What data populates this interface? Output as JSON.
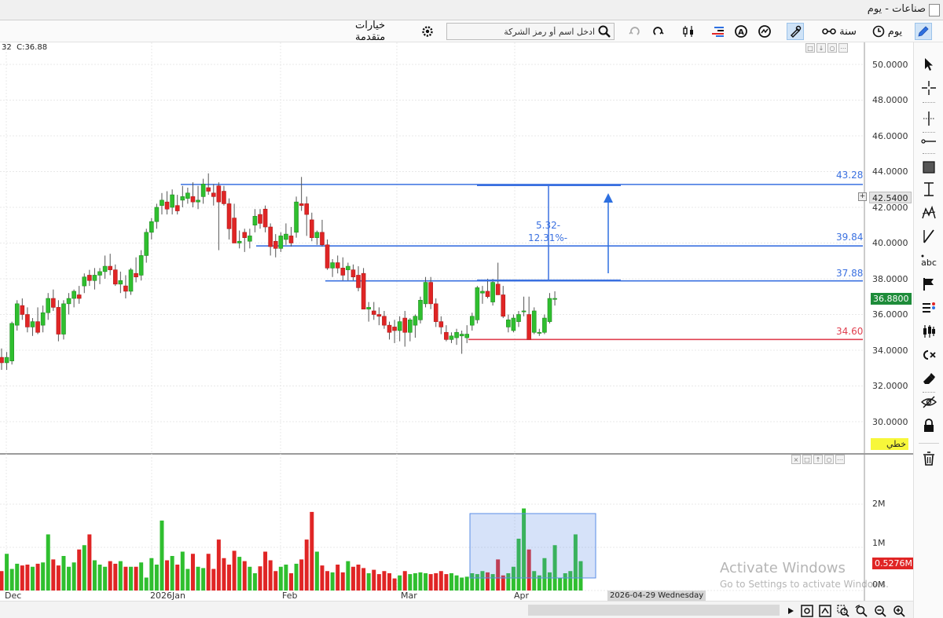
{
  "window": {
    "title": "صناعات - يوم"
  },
  "toolbar": {
    "period_day": "يوم",
    "period_year": "سنة",
    "search_placeholder": "ادخل اسم أو رمز الشركة",
    "advanced_options": "خيارات متقدمة"
  },
  "ohlc_readout": {
    "partial": "32",
    "close": "C:36.88"
  },
  "price_axis": {
    "labels": [
      "50.0000",
      "48.0000",
      "46.0000",
      "44.0000",
      "42.0000",
      "40.0000",
      "38.0000",
      "36.0000",
      "34.0000",
      "32.0000",
      "30.0000"
    ],
    "crosshair_price": "42.5400",
    "last_price": "36.8800",
    "scale_mode": "خطي"
  },
  "volume_axis": {
    "labels": [
      "2M",
      "1M",
      "0M"
    ],
    "last_volume": "0.5276M"
  },
  "date_axis": {
    "labels": [
      "Dec",
      "2026Jan",
      "Feb",
      "Mar",
      "Apr"
    ],
    "cursor_date": "2026-04-29 Wednesday"
  },
  "annotations": {
    "levels": [
      {
        "label": "43.28",
        "price": 43.28,
        "color": "#3a70e0"
      },
      {
        "label": "39.84",
        "price": 39.84,
        "color": "#3a70e0"
      },
      {
        "label": "37.88",
        "price": 37.88,
        "color": "#3a70e0"
      },
      {
        "label": "34.60",
        "price": 34.6,
        "color": "#e04050"
      }
    ],
    "measure_change": "5.32-",
    "measure_percent": "12.31%-"
  },
  "watermark": {
    "line1": "Activate Windows",
    "line2": "Go to Settings to activate Windows."
  },
  "colors": {
    "up": "#2fbf2f",
    "down": "#e02525",
    "level": "#3a70e0",
    "support": "#e04050",
    "last_price_tag": "#1e8c3a"
  },
  "chart_data": {
    "type": "candlestick",
    "ylim": [
      29,
      51
    ],
    "series": [
      {
        "name": "price",
        "ohlc": [
          [
            33.6,
            34.1,
            32.9,
            33.3
          ],
          [
            33.3,
            33.9,
            32.9,
            33.6
          ],
          [
            33.4,
            35.6,
            33.2,
            35.5
          ],
          [
            35.4,
            36.8,
            35.1,
            36.6
          ],
          [
            36.5,
            36.9,
            35.7,
            36.0
          ],
          [
            36.0,
            36.4,
            35.0,
            35.3
          ],
          [
            35.3,
            35.8,
            34.8,
            35.6
          ],
          [
            35.6,
            36.4,
            34.9,
            35.0
          ],
          [
            35.4,
            36.5,
            35.0,
            36.1
          ],
          [
            36.1,
            37.2,
            35.7,
            36.9
          ],
          [
            36.9,
            37.4,
            36.2,
            36.4
          ],
          [
            36.4,
            36.8,
            34.5,
            34.9
          ],
          [
            34.9,
            36.8,
            34.6,
            36.6
          ],
          [
            36.6,
            37.2,
            36.0,
            36.9
          ],
          [
            36.9,
            37.4,
            36.4,
            37.3
          ],
          [
            37.1,
            37.6,
            36.6,
            36.9
          ],
          [
            37.6,
            38.3,
            37.2,
            38.1
          ],
          [
            38.2,
            38.5,
            37.6,
            37.9
          ],
          [
            37.9,
            38.6,
            37.4,
            38.2
          ],
          [
            38.2,
            38.6,
            37.7,
            38.4
          ],
          [
            38.4,
            39.3,
            38.0,
            38.7
          ],
          [
            38.7,
            39.4,
            38.2,
            38.5
          ],
          [
            38.5,
            38.8,
            37.6,
            37.7
          ],
          [
            37.7,
            38.4,
            37.2,
            37.9
          ],
          [
            37.6,
            38.2,
            36.9,
            37.3
          ],
          [
            37.3,
            38.6,
            37.1,
            38.5
          ],
          [
            38.3,
            39.2,
            37.8,
            38.1
          ],
          [
            38.2,
            39.6,
            37.9,
            39.3
          ],
          [
            39.3,
            40.8,
            38.9,
            40.6
          ],
          [
            40.6,
            41.4,
            40.2,
            41.2
          ],
          [
            41.2,
            42.2,
            40.8,
            42.0
          ],
          [
            42.1,
            42.8,
            41.6,
            42.4
          ],
          [
            42.3,
            42.9,
            41.6,
            41.9
          ],
          [
            42.0,
            43.0,
            41.6,
            42.7
          ],
          [
            42.1,
            42.7,
            41.6,
            41.8
          ],
          [
            42.4,
            43.2,
            42.0,
            42.6
          ],
          [
            42.5,
            43.1,
            42.2,
            42.8
          ],
          [
            42.6,
            43.4,
            42.0,
            42.3
          ],
          [
            42.3,
            43.2,
            41.9,
            42.4
          ],
          [
            42.6,
            43.6,
            42.2,
            43.3
          ],
          [
            43.1,
            43.9,
            42.7,
            42.9
          ],
          [
            42.8,
            43.3,
            42.1,
            42.6
          ],
          [
            43.2,
            43.4,
            39.6,
            42.3
          ],
          [
            42.9,
            43.2,
            42.1,
            42.2
          ],
          [
            42.2,
            42.5,
            40.2,
            40.8
          ],
          [
            41.4,
            42.2,
            40.1,
            40.0
          ],
          [
            40.0,
            40.7,
            39.7,
            40.1
          ],
          [
            40.6,
            40.8,
            39.5,
            40.3
          ],
          [
            40.1,
            40.8,
            39.7,
            40.4
          ],
          [
            41.0,
            41.9,
            40.6,
            41.5
          ],
          [
            41.6,
            41.9,
            40.8,
            41.1
          ],
          [
            41.9,
            42.1,
            40.6,
            40.9
          ],
          [
            40.9,
            41.1,
            39.3,
            39.8
          ],
          [
            40.1,
            40.5,
            39.2,
            39.7
          ],
          [
            39.7,
            40.6,
            39.5,
            40.4
          ],
          [
            40.2,
            41.1,
            39.9,
            40.5
          ],
          [
            40.4,
            40.9,
            39.8,
            40.0
          ],
          [
            40.6,
            42.6,
            40.3,
            42.3
          ],
          [
            42.2,
            43.7,
            41.8,
            42.1
          ],
          [
            42.2,
            42.6,
            40.4,
            41.6
          ],
          [
            41.3,
            41.7,
            40.1,
            40.3
          ],
          [
            40.3,
            40.7,
            39.9,
            40.6
          ],
          [
            40.6,
            41.3,
            39.8,
            39.9
          ],
          [
            39.9,
            40.2,
            38.5,
            38.6
          ],
          [
            38.6,
            39.1,
            38.1,
            38.9
          ],
          [
            38.9,
            39.3,
            38.3,
            38.6
          ],
          [
            38.6,
            39.2,
            37.9,
            38.2
          ],
          [
            38.5,
            38.9,
            37.9,
            38.7
          ],
          [
            38.5,
            38.8,
            37.9,
            38.1
          ],
          [
            38.2,
            38.7,
            37.3,
            37.5
          ],
          [
            38.3,
            38.6,
            36.7,
            36.3
          ],
          [
            36.3,
            36.7,
            35.6,
            36.4
          ],
          [
            36.2,
            36.7,
            35.7,
            36.0
          ],
          [
            36.0,
            36.4,
            35.4,
            35.9
          ],
          [
            35.9,
            36.2,
            35.2,
            35.4
          ],
          [
            35.4,
            35.6,
            34.6,
            35.0
          ],
          [
            35.3,
            35.7,
            34.4,
            35.1
          ],
          [
            35.1,
            35.9,
            34.5,
            35.6
          ],
          [
            35.8,
            36.2,
            34.2,
            35.0
          ],
          [
            35.0,
            35.8,
            34.5,
            35.7
          ],
          [
            35.4,
            36.0,
            34.7,
            35.9
          ],
          [
            35.7,
            37.0,
            35.5,
            36.8
          ],
          [
            36.6,
            38.1,
            36.4,
            37.8
          ],
          [
            37.8,
            38.1,
            36.3,
            36.6
          ],
          [
            36.6,
            36.9,
            35.3,
            35.6
          ],
          [
            35.6,
            35.9,
            34.9,
            35.3
          ],
          [
            35.0,
            35.4,
            34.5,
            34.6
          ],
          [
            34.6,
            35.0,
            34.4,
            34.8
          ],
          [
            34.7,
            35.2,
            34.3,
            35.0
          ],
          [
            34.8,
            35.1,
            33.8,
            34.9
          ],
          [
            34.7,
            35.4,
            34.4,
            34.9
          ],
          [
            35.4,
            36.1,
            35.1,
            35.9
          ],
          [
            35.7,
            37.6,
            35.5,
            37.5
          ],
          [
            37.2,
            37.6,
            36.6,
            37.3
          ],
          [
            37.3,
            38.0,
            36.9,
            37.0
          ],
          [
            36.7,
            38.0,
            36.5,
            37.8
          ],
          [
            37.7,
            38.9,
            37.5,
            37.1
          ],
          [
            37.1,
            37.6,
            35.8,
            35.9
          ],
          [
            35.3,
            36.0,
            35.0,
            35.7
          ],
          [
            35.1,
            36.0,
            35.0,
            35.8
          ],
          [
            35.6,
            36.2,
            35.3,
            36.0
          ],
          [
            36.2,
            37.0,
            35.9,
            36.2
          ],
          [
            36.0,
            37.0,
            34.6,
            34.6
          ],
          [
            35.0,
            36.4,
            34.9,
            36.2
          ],
          [
            35.0,
            35.2,
            34.8,
            35.0
          ],
          [
            35.0,
            36.0,
            34.9,
            35.8
          ],
          [
            35.6,
            37.2,
            35.5,
            36.9
          ],
          [
            36.9,
            37.3,
            36.5,
            36.9
          ]
        ]
      },
      {
        "name": "volume",
        "values": [
          0.45,
          0.85,
          0.5,
          0.62,
          0.58,
          0.6,
          0.55,
          0.62,
          0.65,
          1.3,
          0.72,
          0.58,
          0.8,
          0.55,
          0.65,
          0.95,
          1.05,
          1.3,
          0.7,
          0.6,
          0.55,
          0.68,
          0.62,
          0.68,
          0.55,
          0.55,
          0.55,
          0.65,
          0.3,
          0.75,
          0.6,
          1.62,
          0.7,
          0.8,
          0.6,
          0.9,
          0.5,
          0.85,
          0.55,
          0.52,
          0.85,
          0.5,
          1.18,
          0.75,
          0.6,
          0.92,
          0.78,
          0.68,
          0.55,
          0.4,
          0.56,
          0.9,
          0.7,
          0.45,
          0.55,
          0.6,
          0.4,
          0.62,
          0.72,
          1.18,
          1.82,
          0.9,
          0.58,
          0.45,
          0.42,
          0.6,
          0.42,
          0.68,
          0.55,
          0.6,
          0.52,
          0.4,
          0.48,
          0.38,
          0.45,
          0.4,
          0.28,
          0.35,
          0.45,
          0.38,
          0.4,
          0.42,
          0.4,
          0.38,
          0.4,
          0.45,
          0.38,
          0.4,
          0.35,
          0.3,
          0.32,
          0.4,
          0.38,
          0.45,
          0.42,
          0.38,
          0.72,
          0.35,
          0.4,
          0.55,
          1.2,
          1.9,
          0.95,
          0.45,
          0.35,
          0.75,
          0.42,
          1.05,
          0.3,
          0.4,
          0.45,
          1.3,
          0.68
        ]
      }
    ]
  }
}
